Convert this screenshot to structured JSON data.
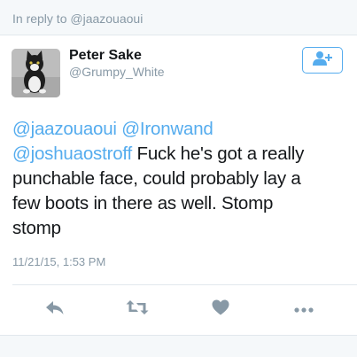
{
  "reply_context": {
    "prefix": "In reply to",
    "mention": "@jaazouaoui"
  },
  "author": {
    "display_name": "Peter Sake",
    "handle": "@Grumpy_White"
  },
  "tweet": {
    "mention_1": "@jaazouaoui",
    "mention_2": "@Ironwand",
    "mention_3": "@joshuaostroff",
    "body_line_1": "Fuck he's got a really",
    "body_line_2": "punchable face, could probably lay a",
    "body_line_3": "few boots in there as well. Stomp",
    "body_line_4": "stomp",
    "timestamp": "11/21/15, 1:53 PM"
  },
  "icons": {
    "follow": "add-user-icon",
    "reply": "reply-icon",
    "retweet": "retweet-icon",
    "like": "heart-icon",
    "more": "more-icon"
  },
  "colors": {
    "accent": "#55acee",
    "muted": "#8899a6",
    "text": "#14171a",
    "background": "#f5f8fa"
  }
}
